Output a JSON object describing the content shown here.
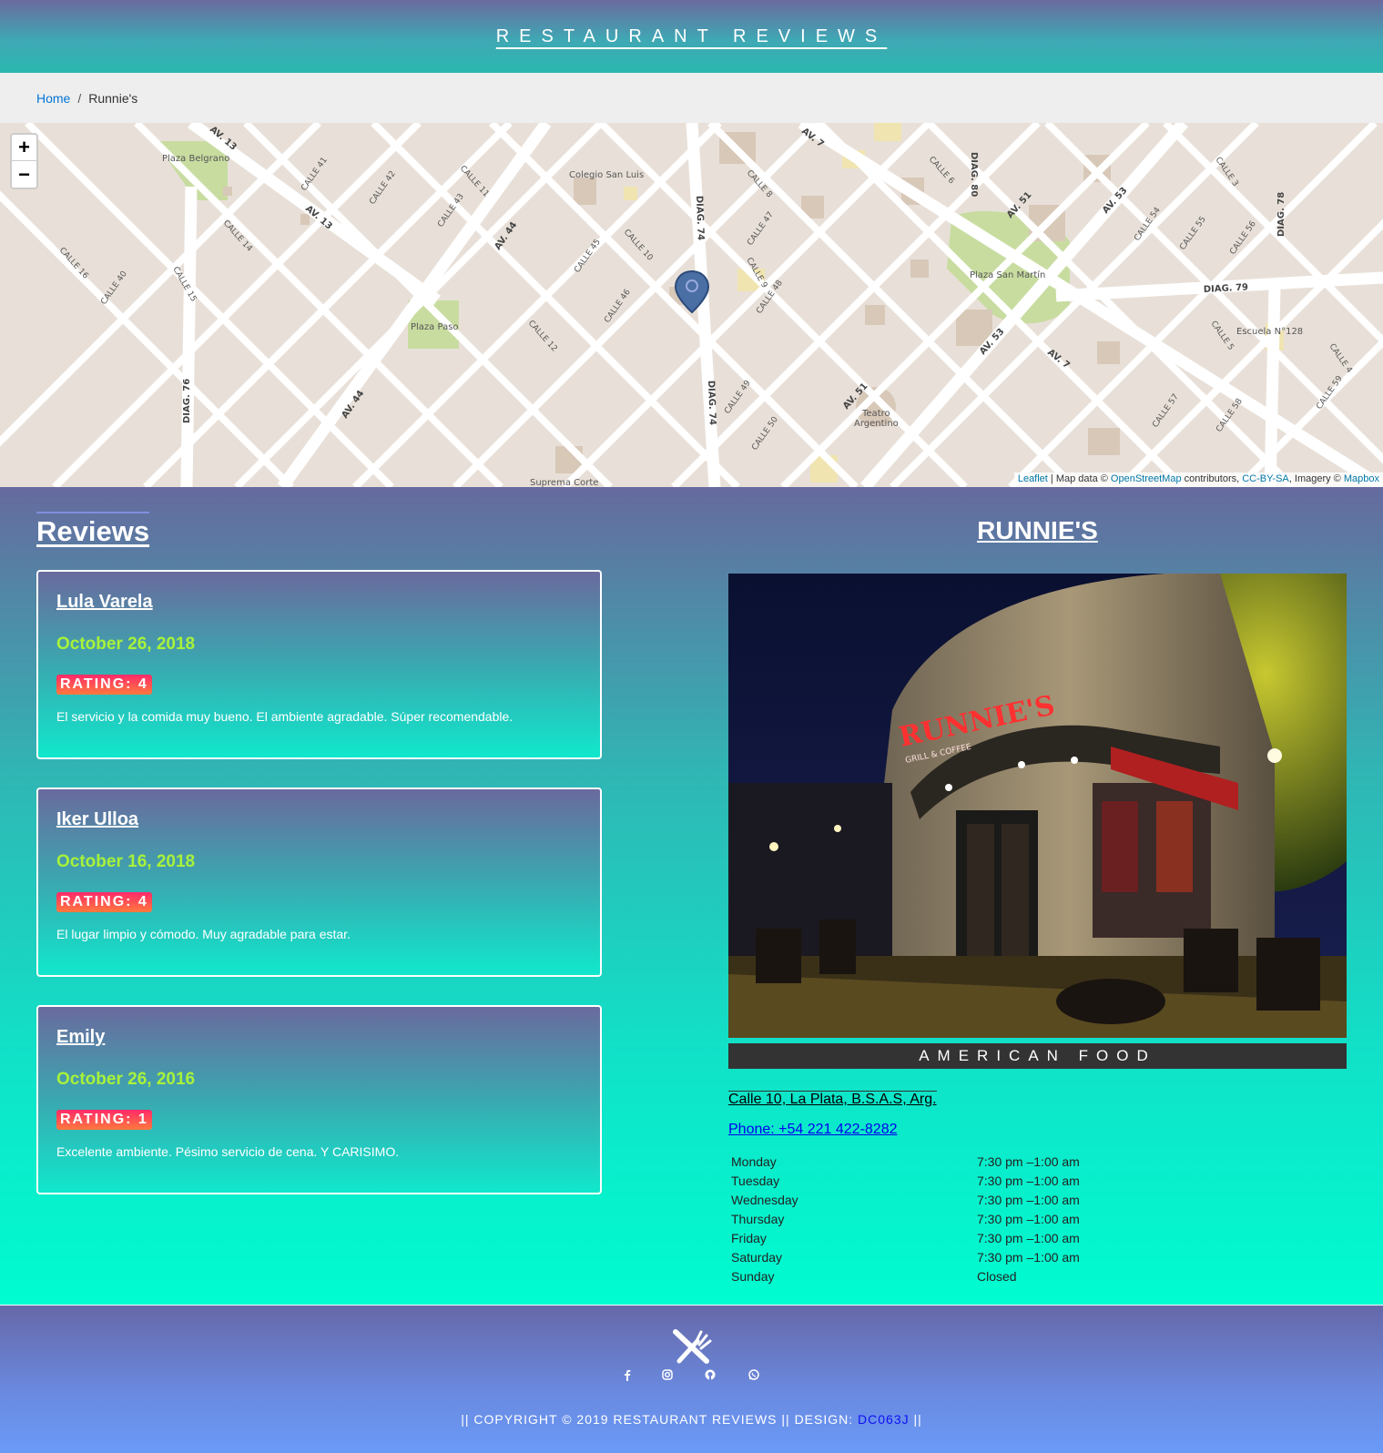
{
  "header": {
    "title": "RESTAURANT REVIEWS"
  },
  "breadcrumb": {
    "home": "Home",
    "separator": "/",
    "current": "Runnie's"
  },
  "map": {
    "zoom_in": "+",
    "zoom_out": "−",
    "attribution": {
      "leaflet": "Leaflet",
      "map_data": " | Map data © ",
      "osm": "OpenStreetMap",
      "contributors": " contributors, ",
      "license": "CC-BY-SA",
      "imagery": ", Imagery © ",
      "mapbox": "Mapbox"
    },
    "labels": {
      "plaza_belgrano": "Plaza Belgrano",
      "colegio": "Colegio San Luis",
      "plaza_paso": "Plaza Paso",
      "plaza_san_martin": "Plaza San Martín",
      "escuela": "Escuela N°128",
      "teatro": "Teatro",
      "argentino": "Argentino",
      "suprema": "Suprema Corte",
      "diag79": "DIAG. 79",
      "diag74": "DIAG. 74",
      "diag74b": "DIAG. 74",
      "diag80": "DIAG. 80",
      "diag76": "DIAG. 76",
      "diag78": "DIAG. 78",
      "av13": "AV. 13",
      "av13b": "AV. 13",
      "av44": "AV. 44",
      "av44b": "AV. 44",
      "av7": "AV. 7",
      "av7b": "AV. 7",
      "av51": "AV. 51",
      "av51b": "AV. 51",
      "av53": "AV. 53",
      "av53b": "AV. 53",
      "calle41": "CALLE 41",
      "calle42": "CALLE 42",
      "calle43": "CALLE 43",
      "calle11": "CALLE 11",
      "calle14": "CALLE 14",
      "calle16": "CALLE 16",
      "calle15": "CALLE 15",
      "calle40": "CALLE 40",
      "calle45": "CALLE 45",
      "calle10": "CALLE 10",
      "calle46": "CALLE 46",
      "calle12": "CALLE 12",
      "calle47": "CALLE 47",
      "calle48": "CALLE 48",
      "calle8": "CALLE 8",
      "calle9": "CALLE 9",
      "calle49": "CALLE 49",
      "calle50": "CALLE 50",
      "calle6": "CALLE 6",
      "calle54": "CALLE 54",
      "calle55": "CALLE 55",
      "calle56": "CALLE 56",
      "calle57": "CALLE 57",
      "calle58": "CALLE 58",
      "calle59": "CALLE 59",
      "calle5": "CALLE 5",
      "calle4": "CALLE 4",
      "calle3": "CALLE 3"
    }
  },
  "reviews": {
    "heading": "Reviews",
    "items": [
      {
        "name": "Lula Varela",
        "date": "October 26, 2018",
        "rating": "RATING: 4",
        "comment": "El servicio y la comida muy bueno. El ambiente agradable. Súper recomendable."
      },
      {
        "name": "Iker Ulloa",
        "date": "October 16, 2018",
        "rating": "RATING: 4",
        "comment": "El lugar limpio y cómodo. Muy agradable para estar."
      },
      {
        "name": "Emily",
        "date": "October 26, 2016",
        "rating": "RATING: 1",
        "comment": "Excelente ambiente. Pésimo servicio de cena. Y CARISIMO."
      }
    ]
  },
  "restaurant": {
    "name": "RUNNIE'S",
    "sign_text": "RUNNIE'S",
    "sign_sub": "GRILL & COFFEE",
    "cuisine": "AMERICAN FOOD",
    "address": "Calle 10, La Plata, B.S.A.S, Arg.",
    "phone": "Phone: +54 221 422-8282",
    "hours": [
      {
        "day": "Monday",
        "time": "7:30 pm –1:00 am"
      },
      {
        "day": "Tuesday",
        "time": "7:30 pm –1:00 am"
      },
      {
        "day": "Wednesday",
        "time": "7:30 pm –1:00 am"
      },
      {
        "day": "Thursday",
        "time": "7:30 pm –1:00 am"
      },
      {
        "day": "Friday",
        "time": "7:30 pm –1:00 am"
      },
      {
        "day": "Saturday",
        "time": "7:30 pm –1:00 am"
      },
      {
        "day": "Sunday",
        "time": "Closed"
      }
    ]
  },
  "footer": {
    "logo_icon": "fork-knife-icon",
    "social_icons": [
      "facebook-icon",
      "instagram-icon",
      "github-icon",
      "whatsapp-icon"
    ],
    "copyright": "|| COPYRIGHT © 2019 RESTAURANT REVIEWS || DESIGN: ",
    "designer": "DC063J",
    "copyright_end": " ||"
  },
  "colors": {
    "accent_green": "#a8f23a",
    "rating_red": "#ff2a6a",
    "link_blue": "#0275d8"
  }
}
